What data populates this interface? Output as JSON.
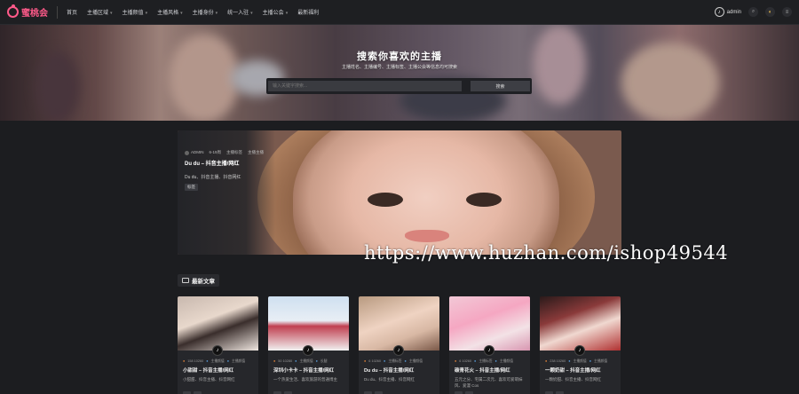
{
  "nav": {
    "logo_text": "蜜桃会",
    "items": [
      {
        "label": "首页",
        "caret": false
      },
      {
        "label": "主播区域",
        "caret": true
      },
      {
        "label": "主播颜值",
        "caret": true
      },
      {
        "label": "主播风格",
        "caret": true
      },
      {
        "label": "主播身份",
        "caret": true
      },
      {
        "label": "统一入驻",
        "caret": true
      },
      {
        "label": "主播公会",
        "caret": true
      },
      {
        "label": "最新福利",
        "caret": false
      }
    ],
    "user_label": "admin",
    "icons": [
      "tiktok-icon",
      "search-icon",
      "moon-icon",
      "menu-icon"
    ]
  },
  "hero": {
    "title": "搜索你喜欢的主播",
    "subtitle": "主播姓名、主播编号、主播标签、主播公会等信息均可搜索",
    "search_placeholder": "输入关键字搜索...",
    "search_button": "搜索"
  },
  "feature": {
    "author": "ADMIN",
    "date": "6-19周",
    "category": "主播标签",
    "tag2": "主播主播",
    "title": "Du du – 抖音主播/网红",
    "desc": "Du du、抖音主播、抖音网红",
    "tag": "标签"
  },
  "watermark": "https://www.huzhan.com/ishop49544",
  "section": {
    "title": "最新文章"
  },
  "cards": [
    {
      "meta1": "158 10260",
      "meta2": "主播颜值",
      "meta3": "主播颜值",
      "title": "小甜甜 – 抖音主播/网红",
      "desc": "小甜甜、抖音主播、抖音网红"
    },
    {
      "meta1": "50 10280",
      "meta2": "主播颜值",
      "meta3": "长腿",
      "title": "深圳小卡卡 – 抖音主播/网红",
      "desc": "一个热爱生活、喜欢旅游的普通博主"
    },
    {
      "meta1": "6 10260",
      "meta2": "主播标签",
      "meta3": "主播颜值",
      "title": "Du du – 抖音主播/网红",
      "desc": "Du du、抖音主播、抖音网红"
    },
    {
      "meta1": "6 10260",
      "meta2": "主播标签",
      "meta3": "主播颜值",
      "title": "碳青花火 – 抖音主播/网红",
      "desc": "五元之分、宅属二次元、喜欢可爱萌妹风、爱漫 Cos"
    },
    {
      "meta1": "238 10260",
      "meta2": "主播颜值",
      "meta3": "主播颜值",
      "title": "一颗奶甜 – 抖音主播/网红",
      "desc": "一颗奶甜、抖音主播、抖音网红"
    }
  ]
}
